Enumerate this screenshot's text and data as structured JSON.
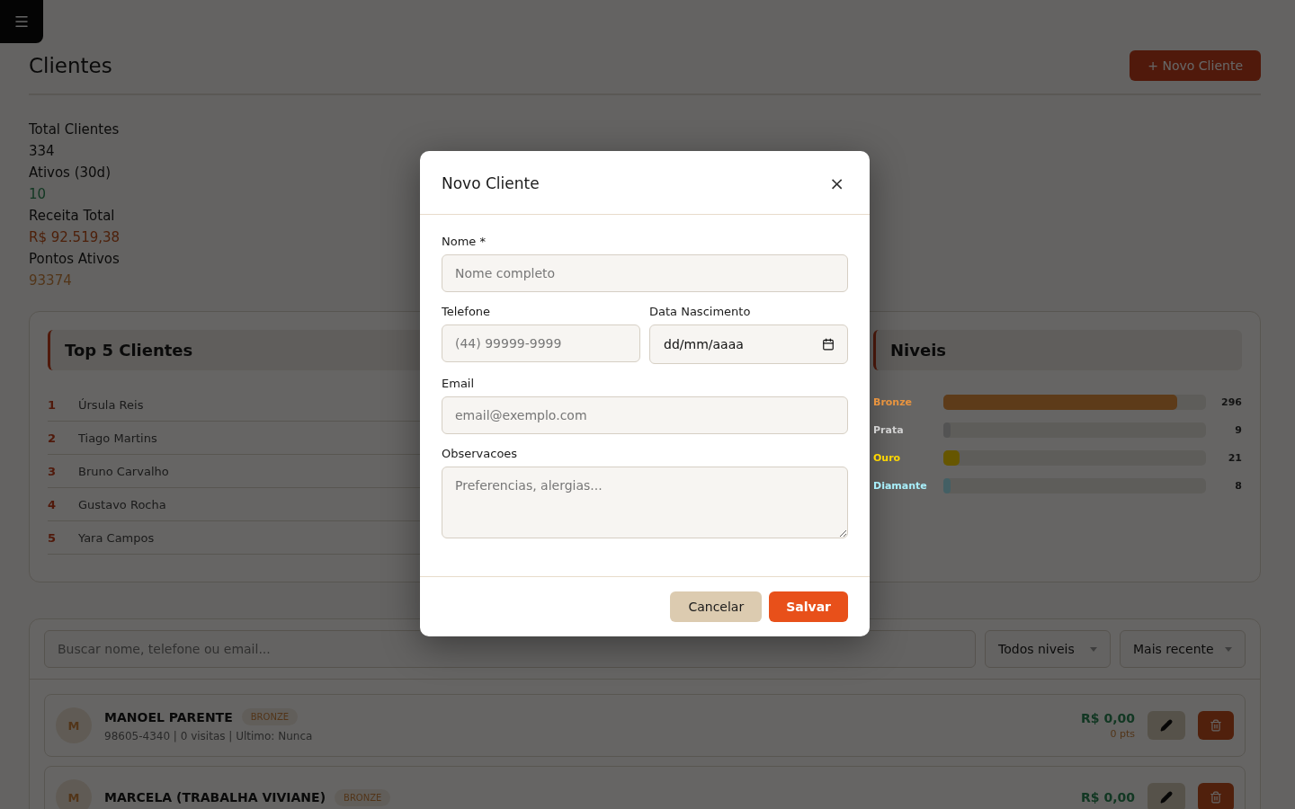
{
  "page": {
    "title": "Clientes",
    "new_button": "+ Novo Cliente"
  },
  "stats": [
    {
      "label": "Total Clientes",
      "value": "334",
      "kind": "plain"
    },
    {
      "label": "Ativos (30d)",
      "value": "10",
      "kind": "green"
    },
    {
      "label": "Receita Total",
      "value": "R$ 92.519,38",
      "kind": "money"
    },
    {
      "label": "Pontos Ativos",
      "value": "93374",
      "kind": "points"
    }
  ],
  "top_clients": {
    "title": "Top 5 Clientes",
    "rows": [
      {
        "rank": "1",
        "name": "Úrsula Reis"
      },
      {
        "rank": "2",
        "name": "Tiago Martins"
      },
      {
        "rank": "3",
        "name": "Bruno Carvalho"
      },
      {
        "rank": "4",
        "name": "Gustavo Rocha"
      },
      {
        "rank": "5",
        "name": "Yara Campos"
      }
    ]
  },
  "levels": {
    "title": "Niveis",
    "rows": [
      {
        "label": "Bronze",
        "count": "296",
        "level": 0.89,
        "color": "#e8943f"
      },
      {
        "label": "Prata",
        "count": "9",
        "level": 0.027,
        "color": "#d0d0d0"
      },
      {
        "label": "Ouro",
        "count": "21",
        "level": 0.063,
        "color": "#ffd700"
      },
      {
        "label": "Diamante",
        "count": "8",
        "level": 0.024,
        "color": "#a8eefa"
      }
    ]
  },
  "filters": {
    "search": {
      "placeholder": "Buscar nome, telefone ou email..."
    },
    "level_select": "Todos niveis",
    "sort_select": "Mais recente"
  },
  "clients": [
    {
      "initial": "M",
      "name": "MANOEL PARENTE",
      "tier": "BRONZE",
      "details": "98605-4340 | 0 visitas | Ultimo: Nunca",
      "amount": "R$ 0,00",
      "points": "0 pts"
    },
    {
      "initial": "M",
      "name": "MARCELA (TRABALHA VIVIANE)",
      "tier": "BRONZE",
      "amount": "R$ 0,00"
    }
  ],
  "modal": {
    "title": "Novo Cliente",
    "close": "×",
    "name_field": {
      "label": "Nome *",
      "placeholder": "Nome completo"
    },
    "phone_field": {
      "label": "Telefone",
      "placeholder": "(44) 99999-9999"
    },
    "birth_field": {
      "label": "Data Nascimento",
      "value": "dd/mm/aaaa"
    },
    "email_field": {
      "label": "Email",
      "placeholder": "email@exemplo.com"
    },
    "notes_field": {
      "label": "Observacoes",
      "placeholder": "Preferencias, alergias..."
    },
    "cancel": "Cancelar",
    "save": "Salvar"
  }
}
